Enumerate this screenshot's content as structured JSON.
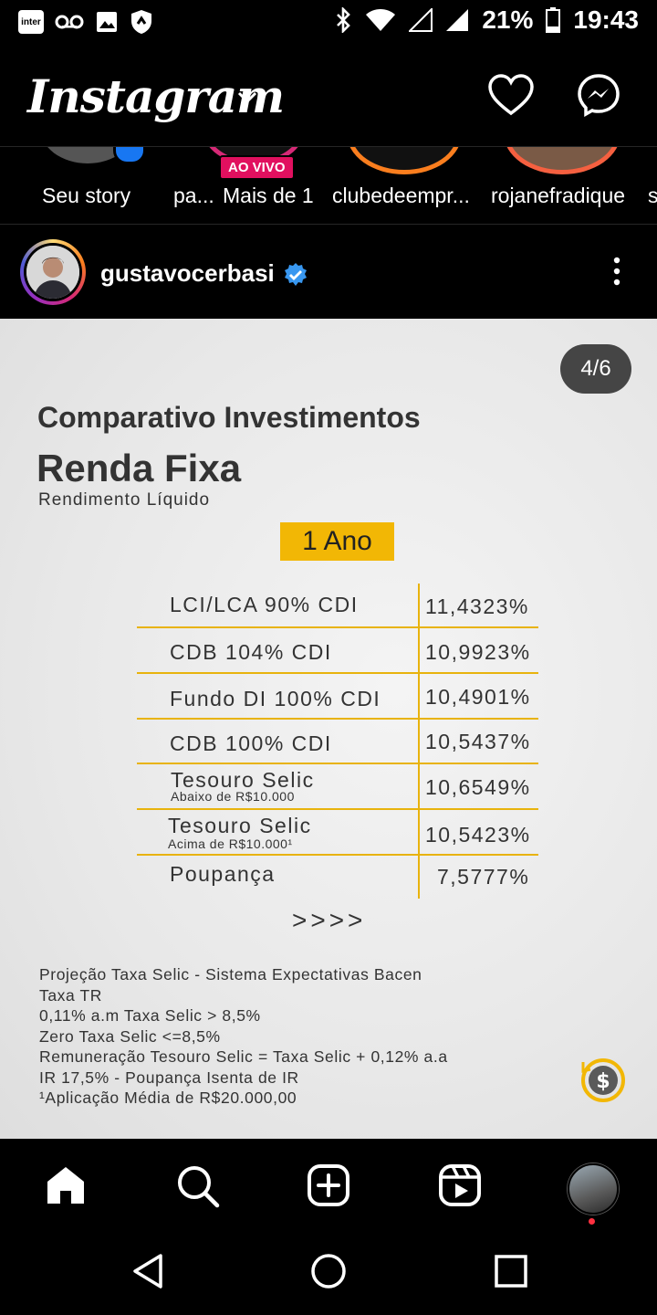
{
  "status_bar": {
    "carrier_chip": "inter",
    "battery": "21%",
    "time": "19:43"
  },
  "app_bar": {
    "logo": "Instagram"
  },
  "stories": [
    {
      "label": "Seu story"
    },
    {
      "label": "pa..."
    },
    {
      "label": "Mais de 1",
      "badge": "AO VIVO"
    },
    {
      "label": "clubedeempr..."
    },
    {
      "label": "rojanefradique"
    },
    {
      "label": "s"
    }
  ],
  "post": {
    "username": "gustavocerbasi",
    "counter": "4/6",
    "title": "Comparativo Investimentos",
    "heading": "Renda Fixa",
    "subheading": "Rendimento Líquido",
    "period": "1 Ano",
    "rows": [
      {
        "name": "LCI/LCA 90% CDI",
        "value": "11,4323%"
      },
      {
        "name": "CDB 104% CDI",
        "value": "10,9923%"
      },
      {
        "name": "Fundo DI 100% CDI",
        "value": "10,4901%"
      },
      {
        "name": "CDB 100% CDI",
        "value": "10,5437%"
      },
      {
        "name": "Tesouro Selic",
        "note": "Abaixo de R$10.000",
        "value": "10,6549%"
      },
      {
        "name": "Tesouro Selic",
        "note": "Acima de R$10.000¹",
        "value": "10,5423%"
      },
      {
        "name": "Poupança",
        "value": "7,5777%"
      }
    ],
    "arrows": ">>>>",
    "notes": [
      "Projeção Taxa Selic - Sistema Expectativas Bacen",
      "Taxa TR",
      "0,11% a.m Taxa Selic > 8,5%",
      "Zero Taxa Selic <=8,5%",
      "Remuneração Tesouro Selic = Taxa Selic + 0,12% a.a",
      "IR 17,5% - Poupança Isenta de IR",
      "¹Aplicação Média de R$20.000,00"
    ]
  },
  "colors": {
    "accent_yellow": "#f2b705",
    "live_pink": "#e1105f",
    "verified_blue": "#3897f0"
  },
  "icons": [
    "home-icon",
    "search-icon",
    "create-icon",
    "reels-icon",
    "heart-icon",
    "messenger-icon",
    "kebab-icon",
    "back-icon",
    "home-circle-icon",
    "recents-icon"
  ]
}
